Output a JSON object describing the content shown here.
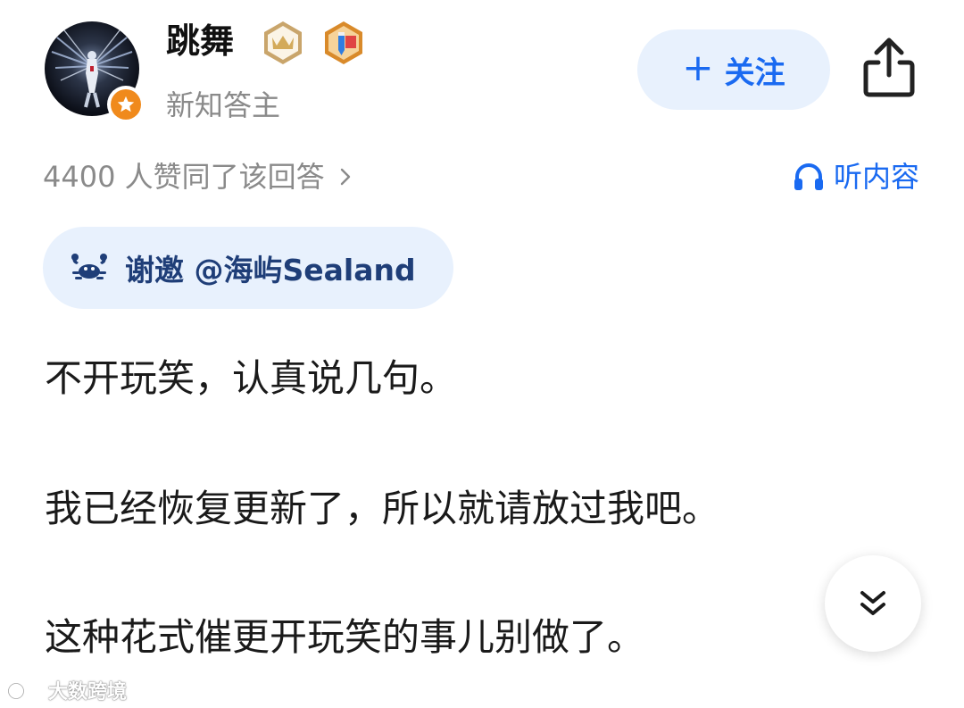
{
  "author": {
    "name": "跳舞",
    "subtitle": "新知答主",
    "avatar_badge_icon": "star-badge-icon",
    "badges": [
      "crown-badge-icon",
      "pencil-badge-icon"
    ]
  },
  "actions": {
    "follow_label": "关注",
    "follow_icon": "plus-icon",
    "share_icon": "share-icon"
  },
  "meta": {
    "upvote_text": "4400 人赞同了该回答",
    "listen_label": "听内容",
    "listen_icon": "headphones-icon"
  },
  "invite": {
    "text": "谢邀 @海屿Sealand",
    "icon": "crab-icon"
  },
  "content": {
    "paragraphs": [
      "不开玩笑，认真说几句。",
      "我已经恢复更新了，所以就请放过我吧。",
      "这种花式催更开玩笑的事儿别做了。"
    ]
  },
  "watermark": {
    "text": "大数跨境"
  },
  "colors": {
    "accent": "#1a6af1",
    "chip_background": "#e8f1fd",
    "invite_text": "#1f3e78",
    "muted_text": "#8a8a8a",
    "badge_orange": "#f08a1c"
  }
}
